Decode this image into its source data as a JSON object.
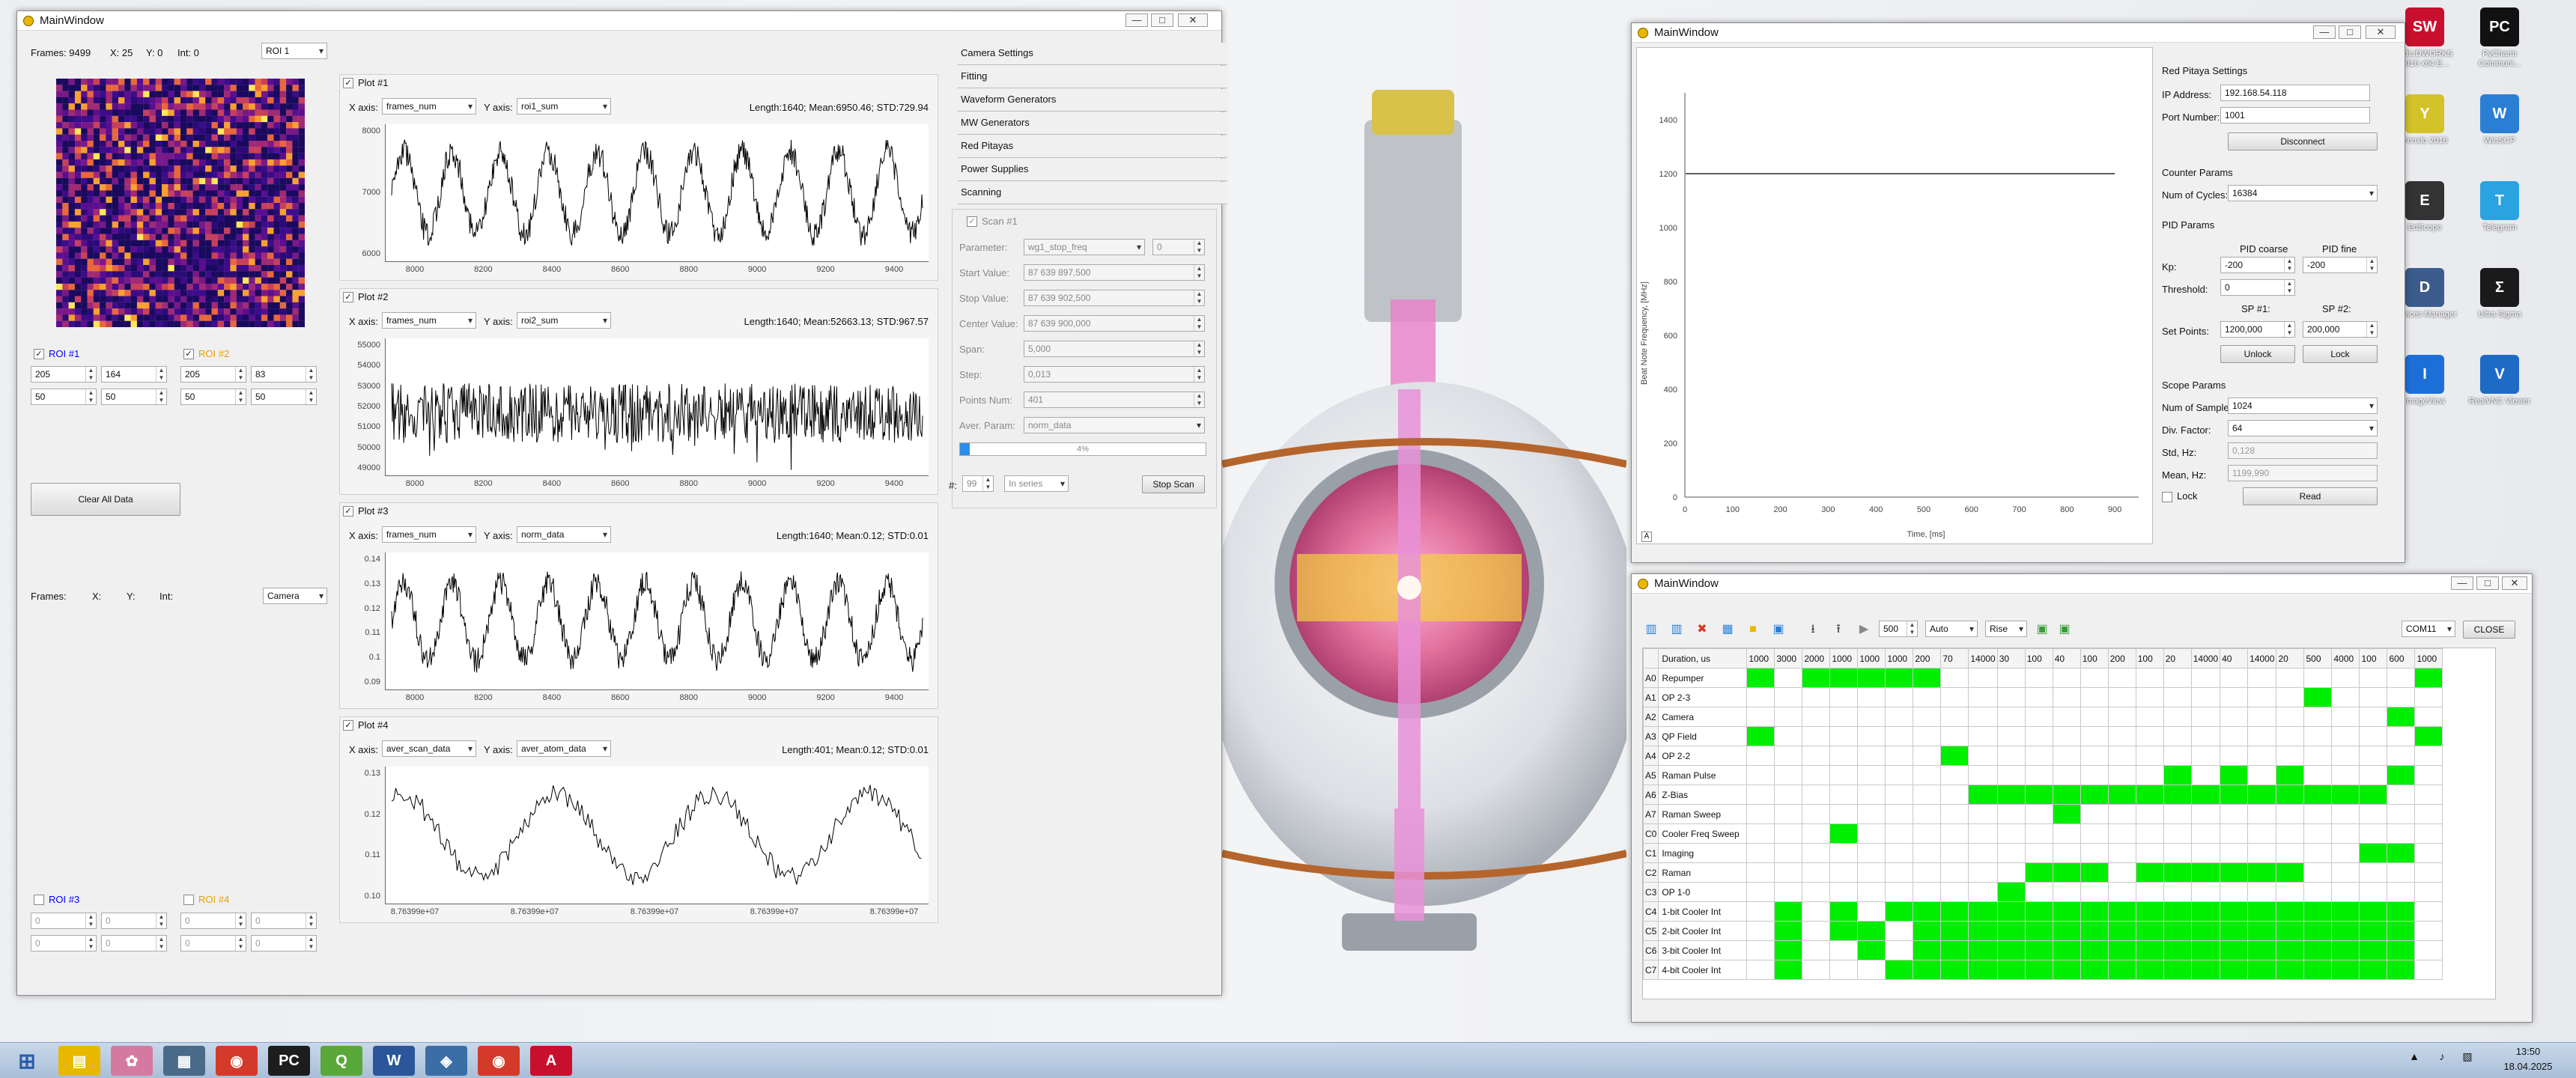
{
  "desktop": {
    "icons": [
      {
        "label": "SOLIDWORKS 2016 x64 E...",
        "color": "#c8102e",
        "glyph": "SW"
      },
      {
        "label": "PyCharm Communi...",
        "color": "#111111",
        "glyph": "PC"
      },
      {
        "label": "Ynnxlo 2016",
        "color": "#d4c22a",
        "glyph": "Y"
      },
      {
        "label": "WinSCP",
        "color": "#2a7fd4",
        "glyph": "W"
      },
      {
        "label": "EdScope",
        "color": "#333333",
        "glyph": "E"
      },
      {
        "label": "Telegram",
        "color": "#2aa3e0",
        "glyph": "T"
      },
      {
        "label": "Devices Manager",
        "color": "#3b5c8c",
        "glyph": "D"
      },
      {
        "label": "Ultra Sigma",
        "color": "#1a1a1a",
        "glyph": "Σ"
      },
      {
        "label": "ImageView",
        "color": "#1d6fd8",
        "glyph": "I"
      },
      {
        "label": "RealVNC Viewer",
        "color": "#1e6bc6",
        "glyph": "V"
      }
    ]
  },
  "taskbar": {
    "time": "13:50",
    "date": "18.04.2025",
    "items": [
      "start-button",
      "file-explorer",
      "app-pinwheel",
      "calculator",
      "chrome",
      "pycharm",
      "qt-creator",
      "word",
      "python",
      "chrome-2",
      "acrobat"
    ]
  },
  "win1": {
    "title": "MainWindow",
    "status": {
      "frames": "Frames: 9499",
      "x": "X: 25",
      "y": "Y: 0",
      "int": "Int: 0"
    },
    "roi_select": "ROI 1",
    "roi1": {
      "label": "ROI #1",
      "checked": true,
      "vals": [
        "205",
        "164",
        "50",
        "50"
      ]
    },
    "roi2": {
      "label": "ROI #2",
      "checked": true,
      "vals": [
        "205",
        "83",
        "50",
        "50"
      ]
    },
    "clear_btn": "Clear All Data",
    "status2": {
      "frames": "Frames:",
      "x": "X:",
      "y": "Y:",
      "int": "Int:"
    },
    "cam_select": "Camera",
    "roi3": {
      "label": "ROI #3",
      "checked": false,
      "vals": [
        "0",
        "0",
        "0",
        "0"
      ]
    },
    "roi4": {
      "label": "ROI #4",
      "checked": false,
      "vals": [
        "0",
        "0",
        "0",
        "0"
      ]
    },
    "plots": [
      {
        "title": "Plot #1",
        "xaxis_label": "X axis:",
        "xaxis": "frames_num",
        "yaxis_label": "Y axis:",
        "yaxis": "roi1_sum",
        "stats": "Length:1640; Mean:6950.46; STD:729.94",
        "yticks": [
          "8000",
          "7000",
          "6000"
        ],
        "xticks": [
          "8000",
          "8200",
          "8400",
          "8600",
          "8800",
          "9000",
          "9200",
          "9400"
        ]
      },
      {
        "title": "Plot #2",
        "xaxis_label": "X axis:",
        "xaxis": "frames_num",
        "yaxis_label": "Y axis:",
        "yaxis": "roi2_sum",
        "stats": "Length:1640; Mean:52663.13; STD:967.57",
        "yticks": [
          "55000",
          "54000",
          "53000",
          "52000",
          "51000",
          "50000",
          "49000"
        ],
        "xticks": [
          "8000",
          "8200",
          "8400",
          "8600",
          "8800",
          "9000",
          "9200",
          "9400"
        ]
      },
      {
        "title": "Plot #3",
        "xaxis_label": "X axis:",
        "xaxis": "frames_num",
        "yaxis_label": "Y axis:",
        "yaxis": "norm_data",
        "stats": "Length:1640; Mean:0.12; STD:0.01",
        "yticks": [
          "0.14",
          "0.13",
          "0.12",
          "0.11",
          "0.1",
          "0.09"
        ],
        "xticks": [
          "8000",
          "8200",
          "8400",
          "8600",
          "8800",
          "9000",
          "9200",
          "9400"
        ]
      },
      {
        "title": "Plot #4",
        "xaxis_label": "X axis:",
        "xaxis": "aver_scan_data",
        "yaxis_label": "Y axis:",
        "yaxis": "aver_atom_data",
        "stats": "Length:401; Mean:0.12; STD:0.01",
        "yticks": [
          "0.13",
          "0.12",
          "0.11",
          "0.10"
        ],
        "xticks": [
          "8.76399e+07",
          "8.76399e+07",
          "8.76399e+07",
          "8.76399e+07",
          "8.76399e+07"
        ]
      }
    ],
    "accordion": [
      "Camera Settings",
      "Fitting",
      "Waveform Generators",
      "MW Generators",
      "Red Pitayas",
      "Power Supplies",
      "Scanning"
    ],
    "scan": {
      "title": "Scan #1",
      "rows": [
        {
          "label": "Parameter:",
          "value": "wg1_stop_freq",
          "extra": "0"
        },
        {
          "label": "Start Value:",
          "value": "87 639 897,500"
        },
        {
          "label": "Stop Value:",
          "value": "87 639 902,500"
        },
        {
          "label": "Center Value:",
          "value": "87 639 900,000"
        },
        {
          "label": "Span:",
          "value": "5,000"
        },
        {
          "label": "Step:",
          "value": "0,013"
        },
        {
          "label": "Points Num:",
          "value": "401"
        },
        {
          "label": "Aver. Param:",
          "value": "norm_data"
        }
      ],
      "progress": "4%",
      "progress_value": 4,
      "count_label": "#:",
      "count": "99",
      "mode": "In series",
      "stop_btn": "Stop Scan"
    }
  },
  "win2": {
    "title": "MainWindow",
    "chart": {
      "ylabel": "Beat Note Frequency, [MHz]",
      "xlabel": "Time, [ms]",
      "yticks": [
        "1400",
        "1200",
        "1000",
        "800",
        "600",
        "400",
        "200",
        "0"
      ],
      "xticks": [
        "0",
        "100",
        "200",
        "300",
        "400",
        "500",
        "600",
        "700",
        "800",
        "900"
      ]
    },
    "panel": {
      "rp_title": "Red Pitaya Settings",
      "ip_label": "IP Address:",
      "ip": "192.168.54.118",
      "port_label": "Port Number:",
      "port": "1001",
      "disconnect": "Disconnect",
      "counter_title": "Counter Params",
      "cycles_label": "Num of Cycles:",
      "cycles": "16384",
      "pid_title": "PID Params",
      "pid_coarse": "PID coarse",
      "pid_fine": "PID fine",
      "kp_label": "Kp:",
      "kp1": "-200",
      "kp2": "-200",
      "thr_label": "Threshold:",
      "thr": "0",
      "sp1": "SP #1:",
      "sp2": "SP #2:",
      "setpoints_label": "Set Points:",
      "sp1_val": "1200,000",
      "sp2_val": "200,000",
      "unlock": "Unlock",
      "lock": "Lock",
      "scope_title": "Scope Params",
      "samples_label": "Num of Samples:",
      "samples": "1024",
      "div_label": "Div. Factor:",
      "div": "64",
      "std_label": "Std, Hz:",
      "std": "0,128",
      "mean_label": "Mean, Hz:",
      "mean": "1199,990",
      "lock_chk": "Lock",
      "read": "Read"
    }
  },
  "win3": {
    "title": "MainWindow",
    "toolbar": {
      "spin": "500",
      "auto": "Auto",
      "rise": "Rise",
      "com": "COM11",
      "close": "CLOSE"
    },
    "header_first": "Duration, us",
    "durations": [
      "1000",
      "3000",
      "2000",
      "1000",
      "1000",
      "1000",
      "200",
      "70",
      "14000",
      "30",
      "100",
      "40",
      "100",
      "200",
      "100",
      "20",
      "14000",
      "40",
      "14000",
      "20",
      "500",
      "4000",
      "100",
      "600",
      "1000"
    ],
    "channels": [
      {
        "id": "A0",
        "name": "Repumper",
        "on": [
          0,
          2,
          3,
          4,
          5,
          6,
          24
        ]
      },
      {
        "id": "A1",
        "name": "OP 2-3",
        "on": [
          20
        ]
      },
      {
        "id": "A2",
        "name": "Camera",
        "on": [
          23
        ]
      },
      {
        "id": "A3",
        "name": "QP Field",
        "on": [
          0,
          24
        ]
      },
      {
        "id": "A4",
        "name": "OP 2-2",
        "on": [
          7
        ]
      },
      {
        "id": "A5",
        "name": "Raman Pulse",
        "on": [
          15,
          17,
          19,
          23
        ]
      },
      {
        "id": "A6",
        "name": "Z-Bias",
        "on": [
          8,
          9,
          10,
          11,
          12,
          13,
          14,
          15,
          16,
          17,
          18,
          19,
          20,
          21,
          22
        ]
      },
      {
        "id": "A7",
        "name": "Raman Sweep",
        "on": [
          11
        ]
      },
      {
        "id": "C0",
        "name": "Cooler Freq Sweep",
        "on": [
          3
        ]
      },
      {
        "id": "C1",
        "name": "Imaging",
        "on": [
          22,
          23
        ]
      },
      {
        "id": "C2",
        "name": "Raman",
        "on": [
          10,
          11,
          12,
          14,
          15,
          16,
          17,
          18,
          19
        ]
      },
      {
        "id": "C3",
        "name": "OP 1-0",
        "on": [
          9
        ]
      },
      {
        "id": "C4",
        "name": "1-bit Cooler Int",
        "on": [
          1,
          3,
          5,
          6,
          7,
          8,
          9,
          10,
          11,
          12,
          13,
          14,
          15,
          16,
          17,
          18,
          19,
          20,
          21,
          22,
          23
        ]
      },
      {
        "id": "C5",
        "name": "2-bit Cooler Int",
        "on": [
          1,
          3,
          4,
          6,
          7,
          8,
          9,
          10,
          11,
          12,
          13,
          14,
          15,
          16,
          17,
          18,
          19,
          20,
          21,
          22,
          23
        ]
      },
      {
        "id": "C6",
        "name": "3-bit Cooler Int",
        "on": [
          1,
          4,
          6,
          7,
          8,
          9,
          10,
          11,
          12,
          13,
          14,
          15,
          16,
          17,
          18,
          19,
          20,
          21,
          22,
          23
        ]
      },
      {
        "id": "C7",
        "name": "4-bit Cooler Int",
        "on": [
          1,
          5,
          6,
          7,
          8,
          9,
          10,
          11,
          12,
          13,
          14,
          15,
          16,
          17,
          18,
          19,
          20,
          21,
          22,
          23
        ]
      }
    ]
  },
  "colors": {
    "heatmap_bg": "#3b0a8a",
    "plot_line": "#000000",
    "on_cell": "#00ee00",
    "roi1": "#0000ff",
    "roi2": "#e8a000"
  }
}
